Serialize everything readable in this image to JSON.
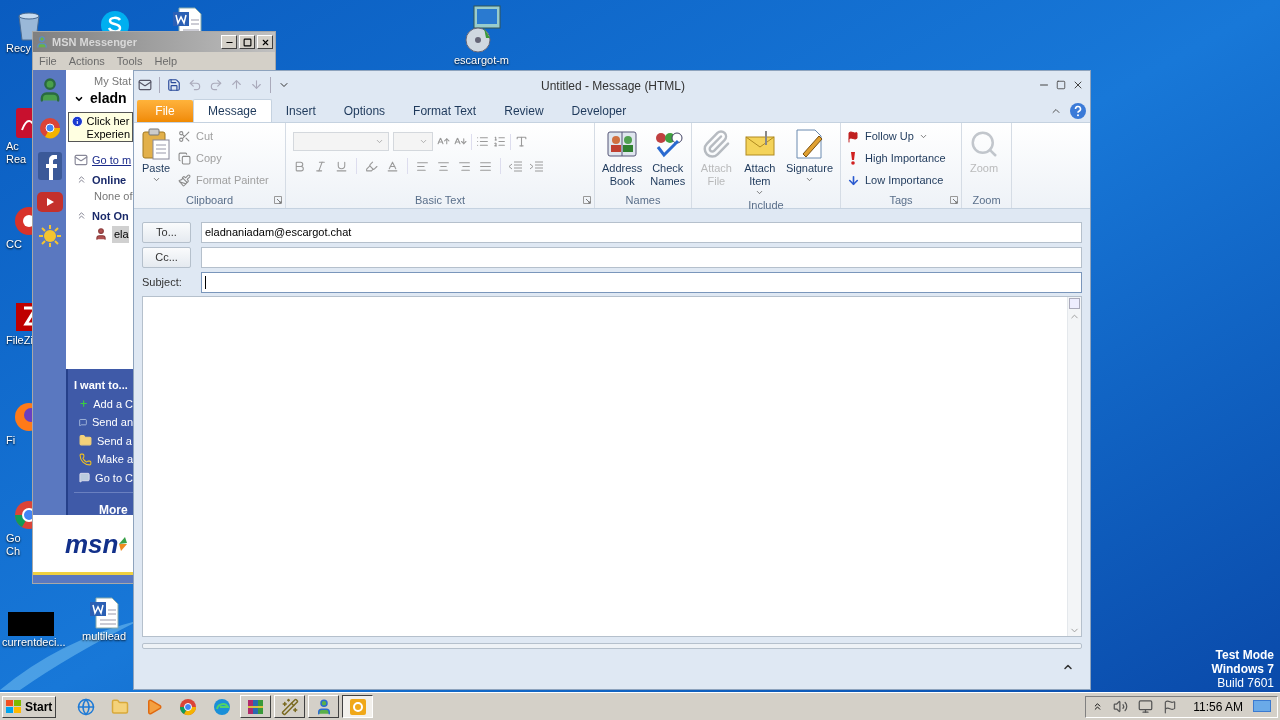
{
  "desktop": {
    "icons": [
      {
        "kind": "recycle",
        "lines": [
          "Recy"
        ]
      },
      {
        "kind": "acrobat",
        "lines": [
          "Ac",
          "Rea"
        ]
      },
      {
        "kind": "ccleaner",
        "lines": [
          "CC"
        ]
      },
      {
        "kind": "filezilla",
        "lines": [
          "FileZi"
        ]
      },
      {
        "kind": "firefox",
        "lines": [
          "Fi"
        ]
      },
      {
        "kind": "chrome",
        "lines": [
          "Go",
          "Ch"
        ]
      },
      {
        "kind": "blackfile",
        "lines": [
          "currentdeci..."
        ]
      },
      {
        "kind": "word",
        "lines": [
          "multilead"
        ]
      },
      {
        "kind": "skype"
      },
      {
        "kind": "word"
      },
      {
        "kind": "installer",
        "lines": [
          "escargot-m"
        ]
      }
    ],
    "os_notice": [
      "Test Mode",
      "Windows 7",
      "Build 7601"
    ]
  },
  "msn": {
    "title": "MSN Messenger",
    "menu": [
      "File",
      "Actions",
      "Tools",
      "Help"
    ],
    "status_label": "My Stat",
    "user": "eladn",
    "notice": [
      "Click her",
      "Experien"
    ],
    "mail_link": "Go to m",
    "groups": [
      {
        "label": "Online",
        "note": "None of"
      },
      {
        "label": "Not On",
        "contacts": [
          {
            "name": "ela",
            "selected": true
          }
        ]
      }
    ],
    "tasks_title": "I want to...",
    "tasks": [
      {
        "kind": "add",
        "label": "Add a C"
      },
      {
        "kind": "message",
        "label": "Send an"
      },
      {
        "kind": "file",
        "label": "Send a"
      },
      {
        "kind": "call",
        "label": "Make a"
      },
      {
        "kind": "chat",
        "label": "Go to C"
      }
    ],
    "more": "More",
    "logo": "msn"
  },
  "outlook": {
    "title": "Untitled - Message (HTML)",
    "tabs": [
      {
        "label": "File",
        "kind": "file",
        "selected": false
      },
      {
        "label": "Message",
        "kind": "tab",
        "selected": true
      },
      {
        "label": "Insert",
        "kind": "tab",
        "selected": false
      },
      {
        "label": "Options",
        "kind": "tab",
        "selected": false
      },
      {
        "label": "Format Text",
        "kind": "tab",
        "selected": false
      },
      {
        "label": "Review",
        "kind": "tab",
        "selected": false
      },
      {
        "label": "Developer",
        "kind": "tab",
        "selected": false
      }
    ],
    "groups": [
      {
        "label": "Clipboard",
        "launcher": true,
        "items": [
          {
            "kind": "large",
            "label": "Paste",
            "dropdown": true,
            "disabled": false
          },
          {
            "kind": "small",
            "label": "Cut",
            "dropdown": false,
            "disabled": true
          },
          {
            "kind": "small",
            "label": "Copy",
            "dropdown": false,
            "disabled": true
          },
          {
            "kind": "small",
            "label": "Format Painter",
            "dropdown": false,
            "disabled": true
          }
        ]
      },
      {
        "label": "Basic Text",
        "launcher": true,
        "items": [
          {
            "kind": "formatting",
            "disabled": true
          }
        ]
      },
      {
        "label": "Names",
        "launcher": false,
        "items": [
          {
            "kind": "large",
            "label": "Address Book",
            "dropdown": false,
            "disabled": false
          },
          {
            "kind": "large",
            "label": "Check Names",
            "dropdown": false,
            "disabled": false
          }
        ]
      },
      {
        "label": "Include",
        "launcher": false,
        "items": [
          {
            "kind": "large",
            "label": "Attach File",
            "dropdown": false,
            "disabled": true
          },
          {
            "kind": "large",
            "label": "Attach Item",
            "dropdown": true,
            "disabled": false
          },
          {
            "kind": "large",
            "label": "Signature",
            "dropdown": true,
            "disabled": false
          }
        ]
      },
      {
        "label": "Tags",
        "launcher": true,
        "items": [
          {
            "kind": "small",
            "label": "Follow Up",
            "dropdown": true,
            "disabled": false
          },
          {
            "kind": "small",
            "label": "High Importance",
            "dropdown": false,
            "disabled": false
          },
          {
            "kind": "small",
            "label": "Low Importance",
            "dropdown": false,
            "disabled": false
          }
        ]
      },
      {
        "label": "Zoom",
        "launcher": false,
        "items": [
          {
            "kind": "large",
            "label": "Zoom",
            "dropdown": false,
            "disabled": true
          }
        ]
      }
    ],
    "fields": [
      {
        "kind": "button",
        "label": "To...",
        "value": "eladnaniadam@escargot.chat",
        "focused": false
      },
      {
        "kind": "button",
        "label": "Cc...",
        "focused": false
      },
      {
        "kind": "label",
        "label": "Subject:",
        "focused": true
      }
    ]
  },
  "taskbar": {
    "start": "Start",
    "apps": [
      {
        "kind": "ie",
        "running": false,
        "selected": false
      },
      {
        "kind": "explorer",
        "running": false,
        "selected": false
      },
      {
        "kind": "media",
        "running": false,
        "selected": false
      },
      {
        "kind": "chrome",
        "running": false,
        "selected": false
      },
      {
        "kind": "edge",
        "running": false,
        "selected": false
      },
      {
        "kind": "archive",
        "running": true,
        "selected": false
      },
      {
        "kind": "wand",
        "running": true,
        "selected": false
      },
      {
        "kind": "messenger",
        "running": true,
        "selected": false
      },
      {
        "kind": "outlook",
        "running": true,
        "selected": true
      }
    ],
    "clock": "11:56 AM"
  }
}
